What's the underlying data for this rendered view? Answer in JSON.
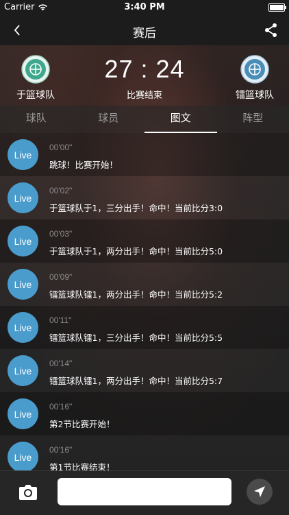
{
  "status_bar": {
    "carrier": "Carrier",
    "time": "3:40 PM"
  },
  "nav": {
    "title": "赛后"
  },
  "scoreboard": {
    "home_team": "于篮球队",
    "away_team": "镭篮球队",
    "score": "27 : 24",
    "status": "比赛结束"
  },
  "tabs": [
    {
      "label": "球队"
    },
    {
      "label": "球员"
    },
    {
      "label": "图文"
    },
    {
      "label": "阵型"
    }
  ],
  "feed": [
    {
      "badge": "Live",
      "time": "00'00\"",
      "text": "跳球！比赛开始！"
    },
    {
      "badge": "Live",
      "time": "00'02\"",
      "text": "于篮球队于1，三分出手！命中！当前比分3:0"
    },
    {
      "badge": "Live",
      "time": "00'03\"",
      "text": "于篮球队于1，两分出手！命中！当前比分5:0"
    },
    {
      "badge": "Live",
      "time": "00'09\"",
      "text": "镭篮球队镭1，两分出手！命中！当前比分5:2"
    },
    {
      "badge": "Live",
      "time": "00'11\"",
      "text": "镭篮球队镭1，三分出手！命中！当前比分5:5"
    },
    {
      "badge": "Live",
      "time": "00'14\"",
      "text": "镭篮球队镭1，两分出手！命中！当前比分5:7"
    },
    {
      "badge": "Live",
      "time": "00'16\"",
      "text": "第2节比赛开始！"
    },
    {
      "badge": "Live",
      "time": "00'16\"",
      "text": "第1节比赛结束！"
    }
  ],
  "input": {
    "value": "",
    "placeholder": ""
  },
  "icons": {
    "back": "chevron-left-icon",
    "share": "share-icon",
    "camera": "camera-icon",
    "send": "send-icon"
  },
  "colors": {
    "live_badge": "#4a9ccc",
    "team_logo": "#3fa88c",
    "tab_active": "#ffffff"
  }
}
